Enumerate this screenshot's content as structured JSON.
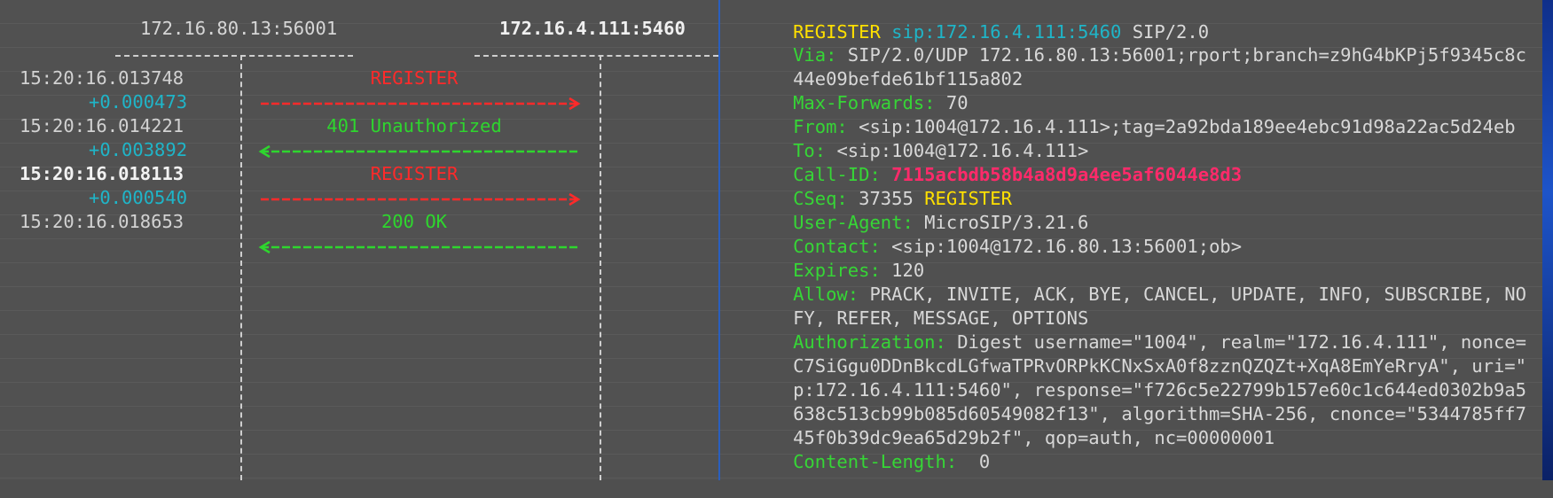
{
  "flow": {
    "hosts": [
      "172.16.80.13:56001",
      "172.16.4.111:5460"
    ],
    "messages": [
      {
        "time": "15:20:16.013748",
        "delta": "+0.000473",
        "label": "REGISTER",
        "direction": "right",
        "color": "#ff2a2a"
      },
      {
        "time": "15:20:16.014221",
        "delta": "+0.003892",
        "label": "401 Unauthorized",
        "direction": "left",
        "color": "#2ed62e"
      },
      {
        "time": "15:20:16.018113",
        "delta": "+0.000540",
        "label": "REGISTER",
        "direction": "right",
        "color": "#ff2a2a"
      },
      {
        "time": "15:20:16.018653",
        "delta": "",
        "label": "200 OK",
        "direction": "left",
        "color": "#2ed62e"
      }
    ],
    "selected_index": 2,
    "delta_color": "#1fb5c8"
  },
  "detail": {
    "request_line": {
      "method": "REGISTER",
      "uri": "sip:172.16.4.111:5460",
      "version": "SIP/2.0"
    },
    "via": {
      "name": "Via:",
      "value": "SIP/2.0/UDP 172.16.80.13:56001;rport;branch=z9hG4bKPj5f9345c8c",
      "cont": "44e09befde61bf115a802"
    },
    "max_forwards": {
      "name": "Max-Forwards:",
      "value": "70"
    },
    "from": {
      "name": "From:",
      "value": "<sip:1004@172.16.4.111>;tag=2a92bda189ee4ebc91d98a22ac5d24eb"
    },
    "to": {
      "name": "To:",
      "value": "<sip:1004@172.16.4.111>"
    },
    "call_id": {
      "name": "Call-ID:",
      "value": "7115acbdb58b4a8d9a4ee5af6044e8d3"
    },
    "cseq": {
      "name": "CSeq:",
      "number": "37355",
      "method": "REGISTER"
    },
    "user_agent": {
      "name": "User-Agent:",
      "value": "MicroSIP/3.21.6"
    },
    "contact": {
      "name": "Contact:",
      "value": "<sip:1004@172.16.80.13:56001;ob>"
    },
    "expires": {
      "name": "Expires:",
      "value": "120"
    },
    "allow": {
      "name": "Allow:",
      "value": "PRACK, INVITE, ACK, BYE, CANCEL, UPDATE, INFO, SUBSCRIBE, NO",
      "cont": "FY, REFER, MESSAGE, OPTIONS"
    },
    "authorization": {
      "name": "Authorization:",
      "value": "Digest username=\"1004\", realm=\"172.16.4.111\", nonce=",
      "cont": [
        "C7SiGgu0DDnBkcdLGfwaTPRvORPkKCNxSxA0f8zznQZQZt+XqA8EmYeRryA\", uri=\"",
        "p:172.16.4.111:5460\", response=\"f726c5e22799b157e60c1c644ed0302b9a5",
        "638c513cb99b085d60549082f13\", algorithm=SHA-256, cnonce=\"5344785ff7",
        "45f0b39dc9ea65d29b2f\", qop=auth, nc=00000001"
      ]
    },
    "content_length": {
      "name": "Content-Length:",
      "value": " 0"
    }
  }
}
